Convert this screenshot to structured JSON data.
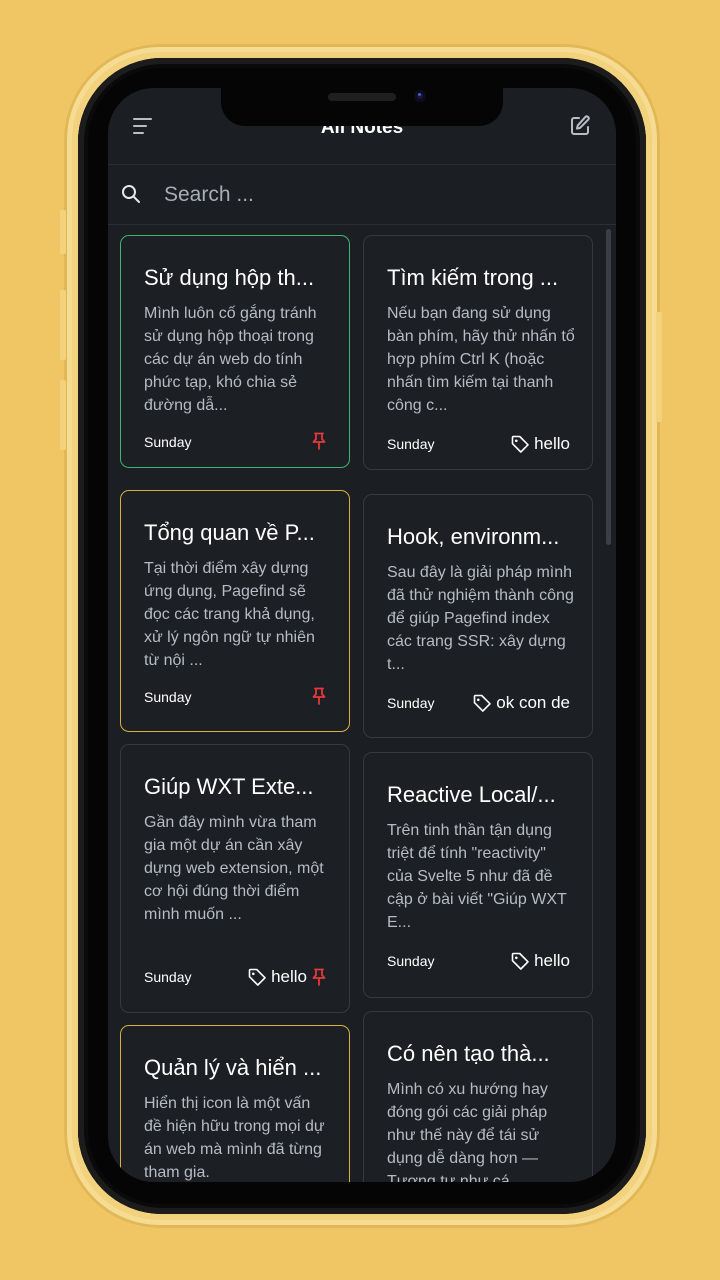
{
  "header": {
    "title": "All Notes",
    "menu_icon": "menu-icon",
    "compose_icon": "edit-note-icon"
  },
  "search": {
    "placeholder": "Search ...",
    "value": "",
    "icon": "search-icon"
  },
  "colors": {
    "background": "#f0c664",
    "screen": "#1b1e23",
    "card_border": "#353a41",
    "pinned_green": "#3fb571",
    "pinned_yellow": "#d9b13a",
    "pin": "#e5383b"
  },
  "notes": [
    {
      "title": "Sử dụng hộp th...",
      "excerpt": "Mình luôn cố gắng tránh sử dụng hộp thoại trong các dự án web do tính phức tạp, khó chia sẻ đường dẫ...",
      "date": "Sunday",
      "tag": "",
      "pinned": true,
      "border": "green"
    },
    {
      "title": "Tìm kiếm trong ...",
      "excerpt": "Nếu bạn đang sử dụng bàn phím, hãy thử nhấn tổ hợp phím Ctrl K (hoặc nhấn tìm kiếm tại thanh công c...",
      "date": "Sunday",
      "tag": "hello",
      "pinned": false,
      "border": "default"
    },
    {
      "title": "Tổng quan về P...",
      "excerpt": "Tại thời điểm xây dựng ứng dụng, Pagefind sẽ đọc các trang khả dụng, xử lý ngôn ngữ tự nhiên từ nội ...",
      "date": "Sunday",
      "tag": "",
      "pinned": true,
      "border": "yellow"
    },
    {
      "title": "Hook, environm...",
      "excerpt": "Sau đây là giải pháp mình đã thử nghiệm thành công để giúp Pagefind index các trang SSR: xây dựng t...",
      "date": "Sunday",
      "tag": "ok con de",
      "pinned": false,
      "border": "default"
    },
    {
      "title": "Giúp WXT Exte...",
      "excerpt": "Gần đây mình vừa tham gia một dự án cần xây dựng web extension, một cơ hội đúng thời điểm mình muốn ...",
      "date": "Sunday",
      "tag": "hello",
      "pinned": true,
      "border": "default"
    },
    {
      "title": "Reactive Local/...",
      "excerpt": "Trên tinh thần tận dụng triệt để tính \"reactivity\" của Svelte 5 như đã đề cập ở bài viết \"Giúp WXT E...",
      "date": "Sunday",
      "tag": "hello",
      "pinned": false,
      "border": "default"
    },
    {
      "title": "Quản lý và hiển ...",
      "excerpt": "Hiển thị icon là một vấn đề hiện hữu trong mọi dự án web mà mình đã từng tham gia.",
      "date": "",
      "tag": "",
      "pinned": false,
      "border": "yellow"
    },
    {
      "title": "Có nên tạo thà...",
      "excerpt": "Mình có xu hướng hay đóng gói các giải pháp như thế này để tái sử dụng dễ dàng hơn — Tương tự như cá...",
      "date": "",
      "tag": "",
      "pinned": false,
      "border": "default"
    }
  ]
}
